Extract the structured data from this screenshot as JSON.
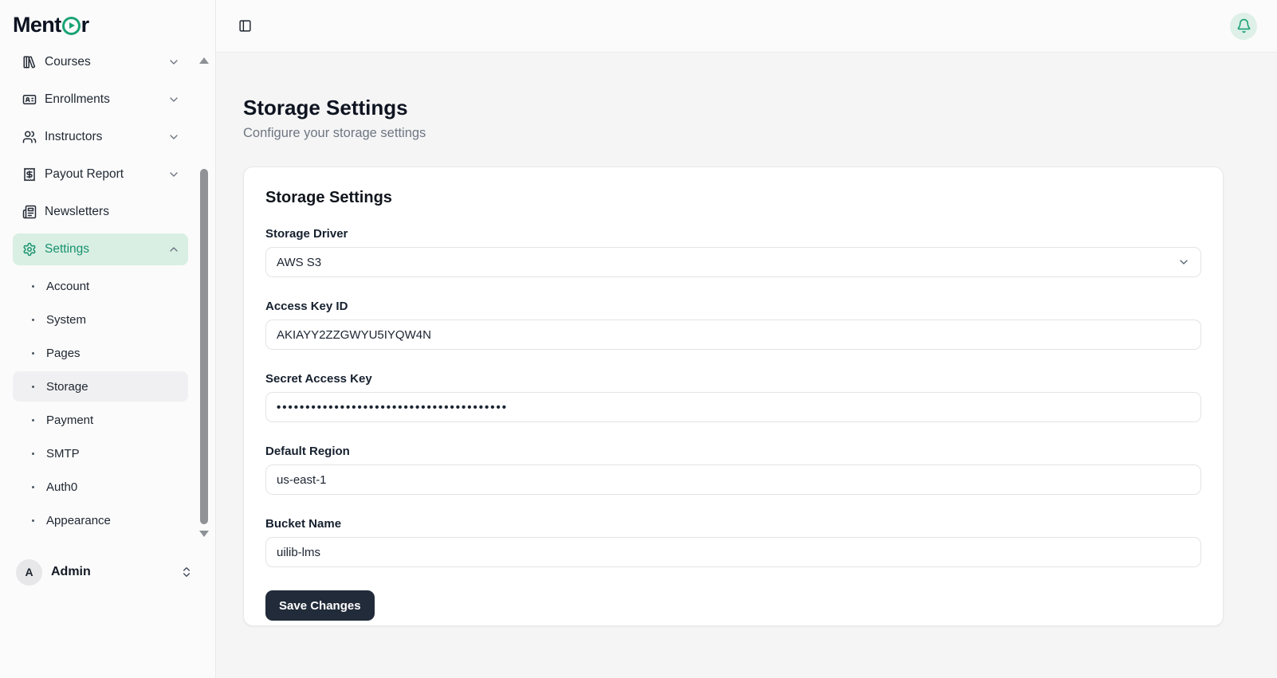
{
  "brand": {
    "prefix": "Ment",
    "suffix": "r"
  },
  "colors": {
    "accent": "#17a075",
    "accent_soft": "#d9efe4",
    "active_item_bg": "#f0f0f2",
    "save_button": "#212b39"
  },
  "sidebar": {
    "items": [
      {
        "label": "Courses",
        "icon": "library-icon",
        "chevron": "down"
      },
      {
        "label": "Enrollments",
        "icon": "id-card-icon",
        "chevron": "down"
      },
      {
        "label": "Instructors",
        "icon": "users-icon",
        "chevron": "down"
      },
      {
        "label": "Payout Report",
        "icon": "receipt-icon",
        "chevron": "down"
      },
      {
        "label": "Newsletters",
        "icon": "newspaper-icon",
        "chevron": null
      },
      {
        "label": "Settings",
        "icon": "gear-icon",
        "chevron": "up",
        "active": true
      }
    ],
    "settings_children": [
      {
        "label": "Account"
      },
      {
        "label": "System"
      },
      {
        "label": "Pages"
      },
      {
        "label": "Storage",
        "active": true
      },
      {
        "label": "Payment"
      },
      {
        "label": "SMTP"
      },
      {
        "label": "Auth0"
      },
      {
        "label": "Appearance"
      }
    ],
    "user": {
      "initial": "A",
      "name": "Admin"
    }
  },
  "page": {
    "title": "Storage Settings",
    "subtitle": "Configure your storage settings"
  },
  "card": {
    "title": "Storage Settings",
    "fields": {
      "driver": {
        "label": "Storage Driver",
        "value": "AWS S3"
      },
      "access_key": {
        "label": "Access Key ID",
        "value": "AKIAYY2ZZGWYU5IYQW4N"
      },
      "secret_key": {
        "label": "Secret Access Key",
        "value": "••••••••••••••••••••••••••••••••••••••••"
      },
      "region": {
        "label": "Default Region",
        "value": "us-east-1"
      },
      "bucket": {
        "label": "Bucket Name",
        "value": "uilib-lms"
      }
    },
    "save_label": "Save Changes"
  }
}
